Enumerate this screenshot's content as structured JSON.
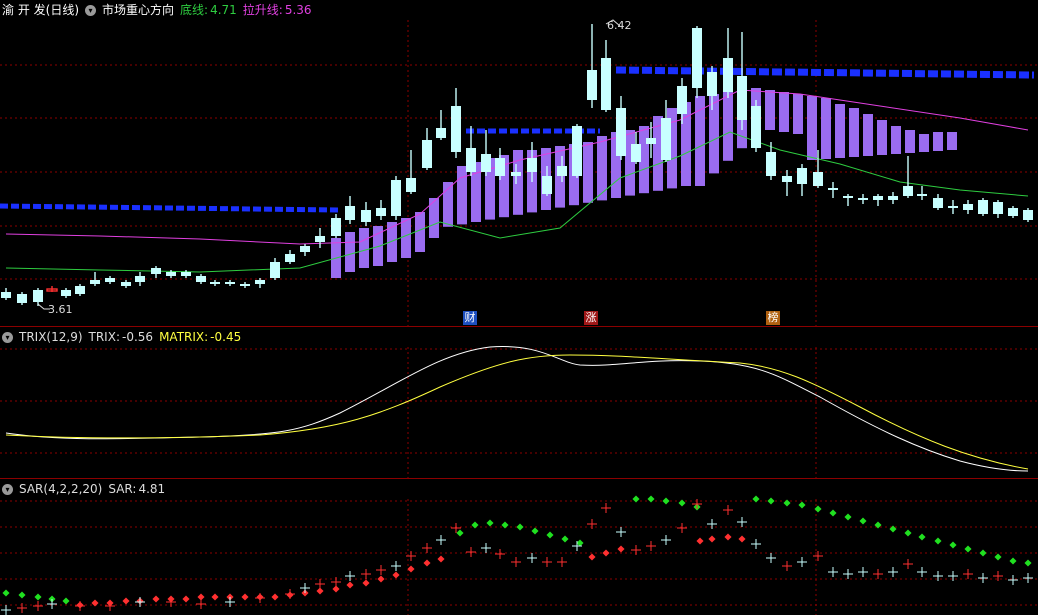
{
  "main": {
    "stock": "渝 开 发",
    "period": "(日线)",
    "indicator": "市场重心方向",
    "base_label": "底线:",
    "base_value": "4.71",
    "lift_label": "拉升线:",
    "lift_value": "5.36",
    "high_marker": "6.42",
    "low_marker": "3.61",
    "badges": [
      "财",
      "涨",
      "榜"
    ],
    "colors": {
      "up": "#ff3030",
      "down": "#c8ffff",
      "bar": "#9a6cf0",
      "blue": "#1a30ff",
      "green": "#2ecc40",
      "magenta": "#e040e0",
      "grid": "#8b0000"
    }
  },
  "trix": {
    "name": "TRIX(12,9)",
    "trix_label": "TRIX:",
    "trix_value": "-0.56",
    "matrix_label": "MATRIX:",
    "matrix_value": "-0.45"
  },
  "sar": {
    "name": "SAR(4,2,2,20)",
    "sar_label": "SAR:",
    "sar_value": "4.81"
  }
}
